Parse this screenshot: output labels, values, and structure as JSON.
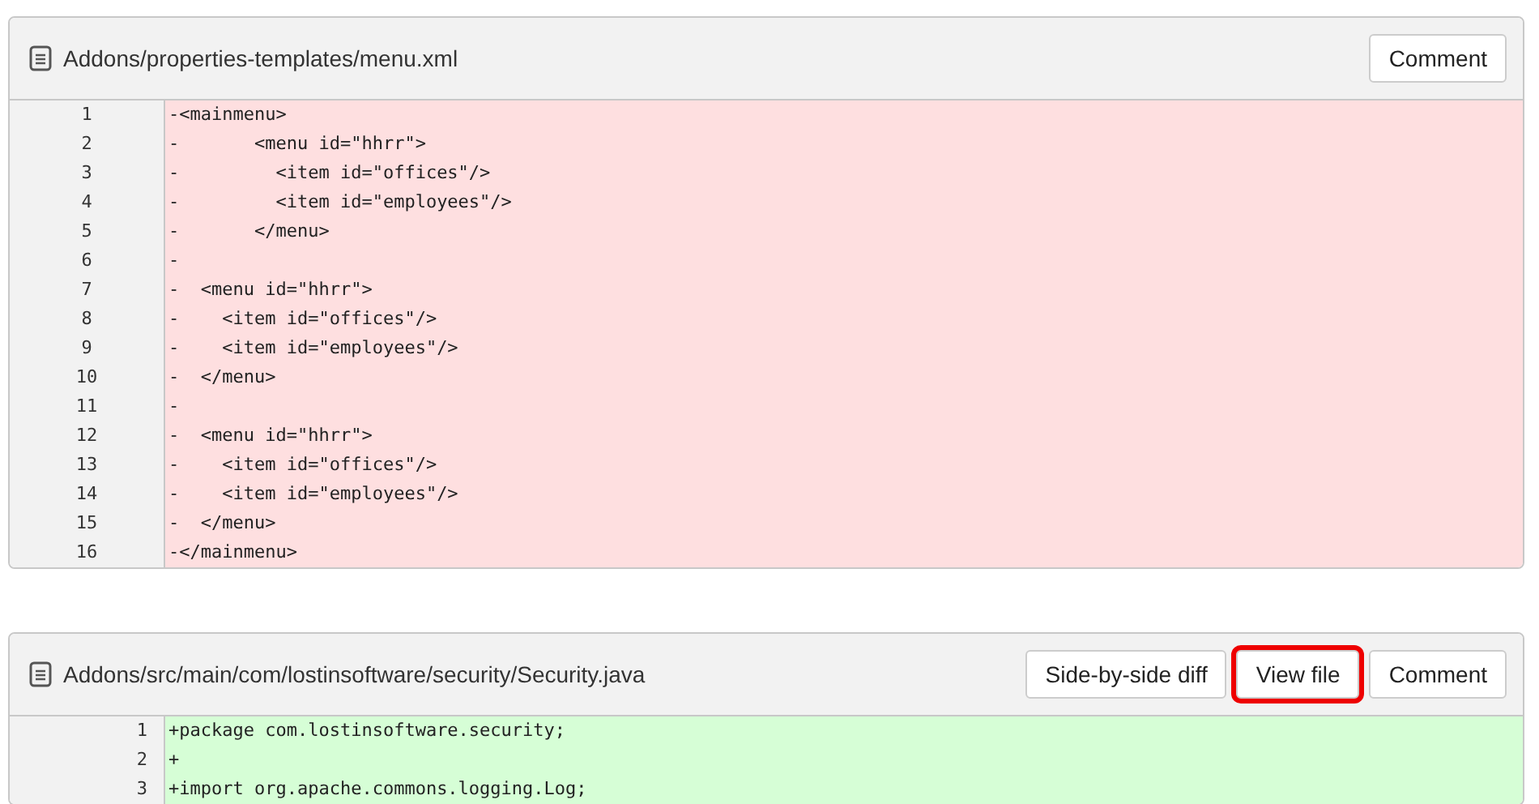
{
  "files": [
    {
      "path": "Addons/properties-templates/menu.xml",
      "buttons": [
        {
          "label": "Comment",
          "highlighted": false
        }
      ],
      "lines": [
        {
          "number": "1",
          "kind": "removed",
          "code": "-<mainmenu>"
        },
        {
          "number": "2",
          "kind": "removed",
          "code": "-       <menu id=\"hhrr\">"
        },
        {
          "number": "3",
          "kind": "removed",
          "code": "-         <item id=\"offices\"/>"
        },
        {
          "number": "4",
          "kind": "removed",
          "code": "-         <item id=\"employees\"/>"
        },
        {
          "number": "5",
          "kind": "removed",
          "code": "-       </menu>"
        },
        {
          "number": "6",
          "kind": "removed",
          "code": "-"
        },
        {
          "number": "7",
          "kind": "removed",
          "code": "-  <menu id=\"hhrr\">"
        },
        {
          "number": "8",
          "kind": "removed",
          "code": "-    <item id=\"offices\"/>"
        },
        {
          "number": "9",
          "kind": "removed",
          "code": "-    <item id=\"employees\"/>"
        },
        {
          "number": "10",
          "kind": "removed",
          "code": "-  </menu>"
        },
        {
          "number": "11",
          "kind": "removed",
          "code": "-"
        },
        {
          "number": "12",
          "kind": "removed",
          "code": "-  <menu id=\"hhrr\">"
        },
        {
          "number": "13",
          "kind": "removed",
          "code": "-    <item id=\"offices\"/>"
        },
        {
          "number": "14",
          "kind": "removed",
          "code": "-    <item id=\"employees\"/>"
        },
        {
          "number": "15",
          "kind": "removed",
          "code": "-  </menu>"
        },
        {
          "number": "16",
          "kind": "removed",
          "code": "-</mainmenu>"
        }
      ]
    },
    {
      "path": "Addons/src/main/com/lostinsoftware/security/Security.java",
      "buttons": [
        {
          "label": "Side-by-side diff",
          "highlighted": false
        },
        {
          "label": "View file",
          "highlighted": true
        },
        {
          "label": "Comment",
          "highlighted": false
        }
      ],
      "lines": [
        {
          "number": "1",
          "kind": "added",
          "code": "+package com.lostinsoftware.security;"
        },
        {
          "number": "2",
          "kind": "added",
          "code": "+"
        },
        {
          "number": "3",
          "kind": "added",
          "code": "+import org.apache.commons.logging.Log;"
        }
      ]
    }
  ]
}
